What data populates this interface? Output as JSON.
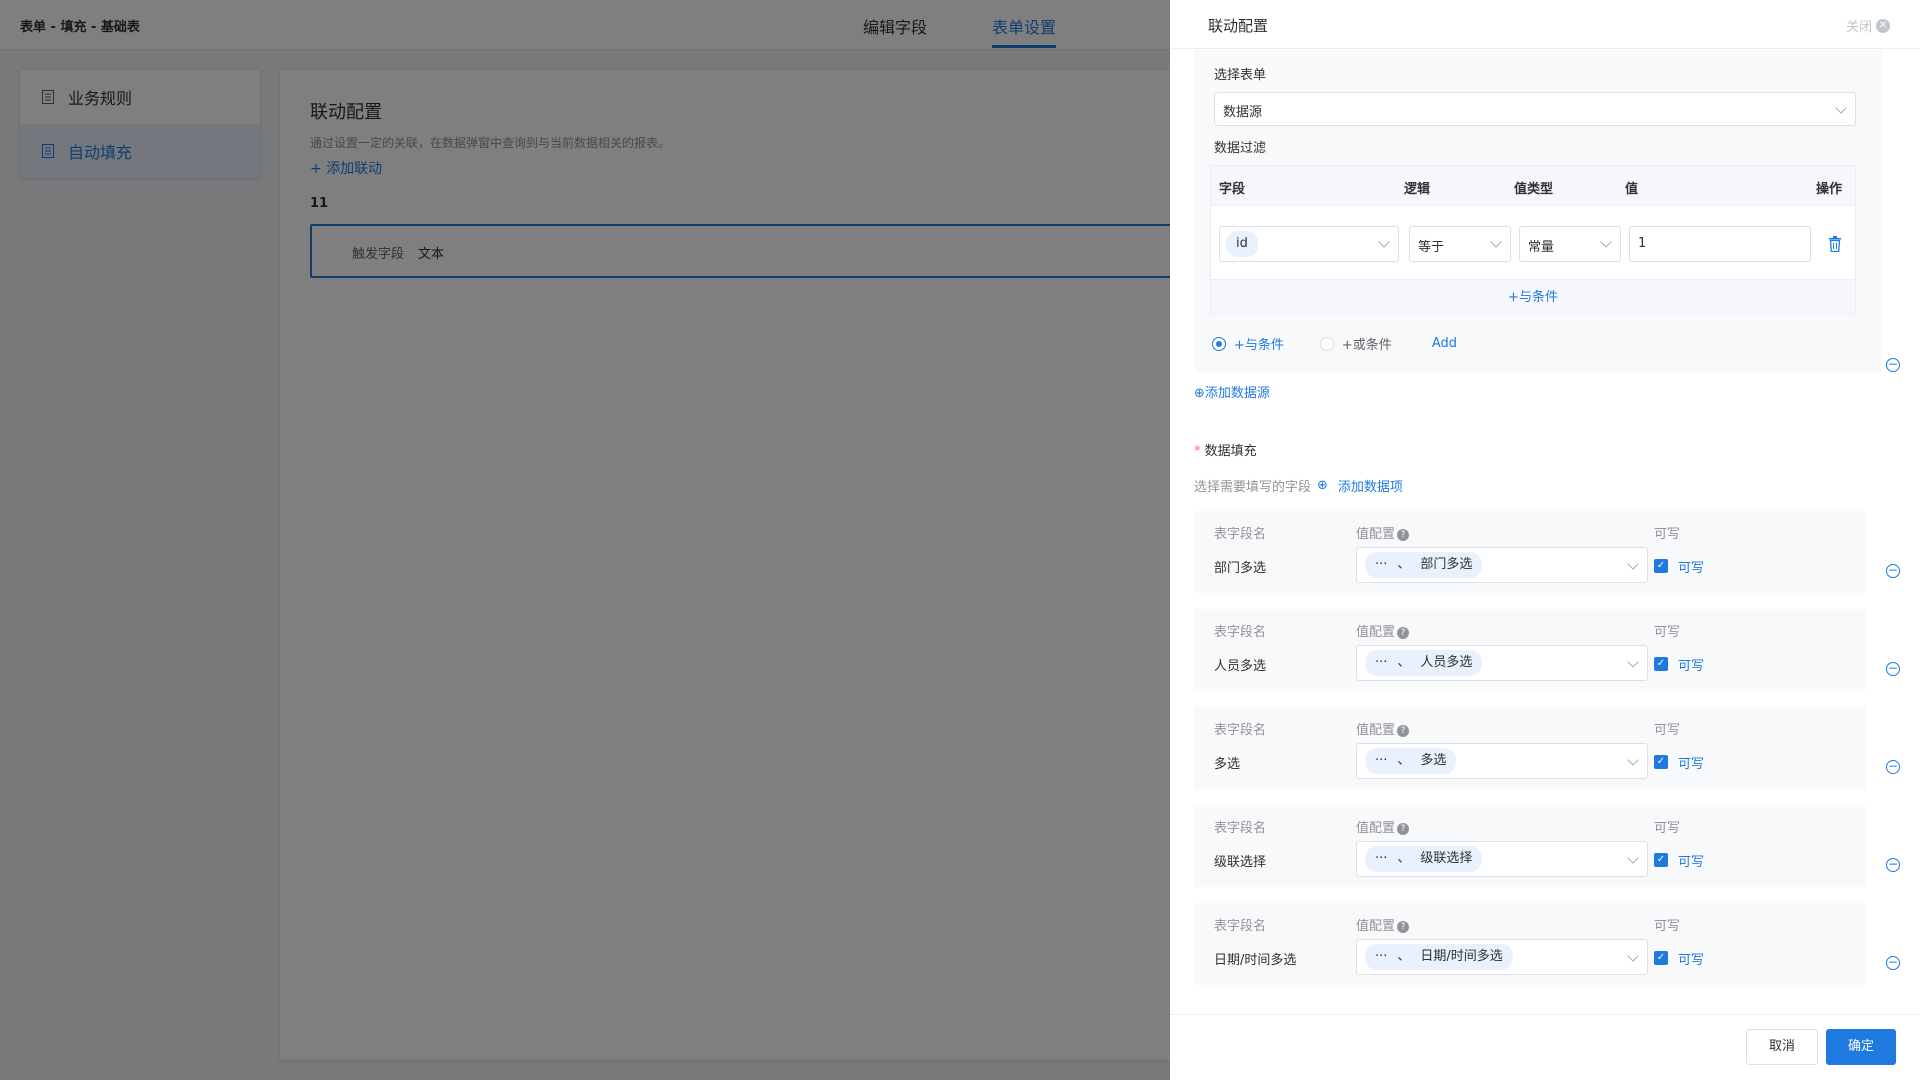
{
  "topbar": {
    "title": "表单 - 填充 - 基础表",
    "tabs": [
      "编辑字段",
      "表单设置"
    ]
  },
  "leftnav": {
    "items": [
      "业务规则",
      "自动填充"
    ]
  },
  "main": {
    "heading": "联动配置",
    "desc": "通过设置一定的关联，在数据弹窗中查询到与当前数据相关的报表。",
    "add_link": "添加联动",
    "rule_number": "11",
    "trigger_label": "触发字段",
    "trigger_value": "文本"
  },
  "drawer": {
    "title": "联动配置",
    "close_label": "关闭",
    "select_form_label": "选择表单",
    "select_form_value": "数据源",
    "filter_label": "数据过滤",
    "filter_headers": [
      "字段",
      "逻辑",
      "值类型",
      "值",
      "操作"
    ],
    "filter_row": {
      "field": "id",
      "logic": "等于",
      "value_type": "常量",
      "value": "1"
    },
    "and_condition": "+与条件",
    "radio_and": "+与条件",
    "radio_or": "+或条件",
    "add_label": "Add",
    "add_datasource": "添加数据源",
    "fill_title": "数据填充",
    "fill_hint": "选择需要填写的字段",
    "add_data_item": "添加数据项",
    "fill_headers": {
      "name": "表字段名",
      "config": "值配置",
      "writable": "可写"
    },
    "fill_rows": [
      {
        "name": "部门多选",
        "prefix": "···",
        "sep": "、",
        "value": "部门多选",
        "writable": "可写"
      },
      {
        "name": "人员多选",
        "prefix": "···",
        "sep": "、",
        "value": "人员多选",
        "writable": "可写"
      },
      {
        "name": "多选",
        "prefix": "···",
        "sep": "、",
        "value": "多选",
        "writable": "可写"
      },
      {
        "name": "级联选择",
        "prefix": "···",
        "sep": "、",
        "value": "级联选择",
        "writable": "可写"
      },
      {
        "name": "日期/时间多选",
        "prefix": "···",
        "sep": "、",
        "value": "日期/时间多选",
        "writable": "可写"
      }
    ],
    "cancel": "取消",
    "confirm": "确定"
  },
  "colors": {
    "accent": "#1f7ae0",
    "mask": "rgba(0,0,0,0.5)"
  }
}
